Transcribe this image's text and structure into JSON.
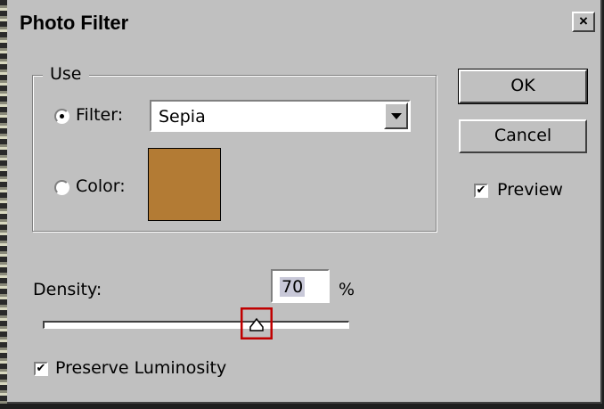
{
  "window": {
    "title": "Photo Filter",
    "close_glyph": "×"
  },
  "use_group": {
    "legend": "Use",
    "filter_option": {
      "label": "Filter:",
      "selected": true,
      "value": "Sepia"
    },
    "color_option": {
      "label": "Color:",
      "selected": false,
      "swatch_color": "#B37B34"
    }
  },
  "buttons": {
    "ok": "OK",
    "cancel": "Cancel"
  },
  "preview": {
    "label": "Preview",
    "checked": true
  },
  "density": {
    "label": "Density:",
    "value": "70",
    "unit": "%",
    "slider_percent": 70
  },
  "preserve_luminosity": {
    "label": "Preserve Luminosity",
    "checked": true
  },
  "colors": {
    "dialog_bg": "#C0C0C0",
    "highlight_box": "#C00000"
  }
}
